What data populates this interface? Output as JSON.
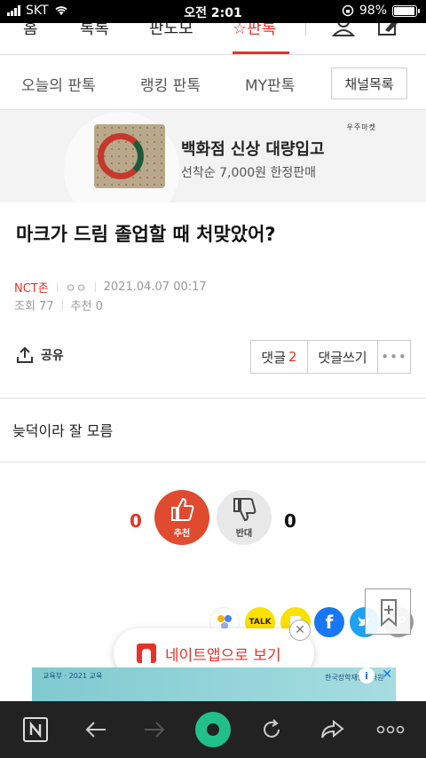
{
  "status_bar": {
    "carrier": "SKT",
    "time": "오전 2:01",
    "battery": "98%"
  },
  "top_nav": {
    "items": [
      "홈",
      "톡톡",
      "판노모",
      "☆판톡"
    ]
  },
  "sub_tabs": {
    "items": [
      "오늘의 판톡",
      "랭킹 판톡",
      "MY판톡"
    ],
    "channel_button": "채널목록"
  },
  "ad": {
    "brand": "우주마켓",
    "headline": "백화점 신상 대량입고",
    "subline": "선착순 7,000원 한정판매"
  },
  "post": {
    "title": "마크가 드림 졸업할 때 처맞았어?",
    "nickname": "NCT존",
    "extra": "ㅇㅇ",
    "datetime": "2021.04.07 00:17",
    "views": "조회 77",
    "recommends": "추천 0",
    "share_label": "공유",
    "comment_label": "댓글",
    "comment_count": "2",
    "write_comment_label": "댓글쓰기",
    "more_label": "•••",
    "body": "늦덕이라 잘 모름"
  },
  "votes": {
    "up_count": "0",
    "up_label": "추천",
    "down_count": "0",
    "down_label": "반대"
  },
  "share_icons": {
    "kakaotalk_label": "TALK",
    "facebook_label": "f"
  },
  "nate_banner": {
    "text": "네이트앱으로 보기"
  },
  "bottom_ad": {
    "left_text": "교육부  · 2021 교육",
    "right_text": "한국장학재단 · 서원",
    "info": "i",
    "close": "✕"
  },
  "colors": {
    "accent": "#e63329",
    "toolbar": "#222222",
    "home": "#21c08b"
  }
}
